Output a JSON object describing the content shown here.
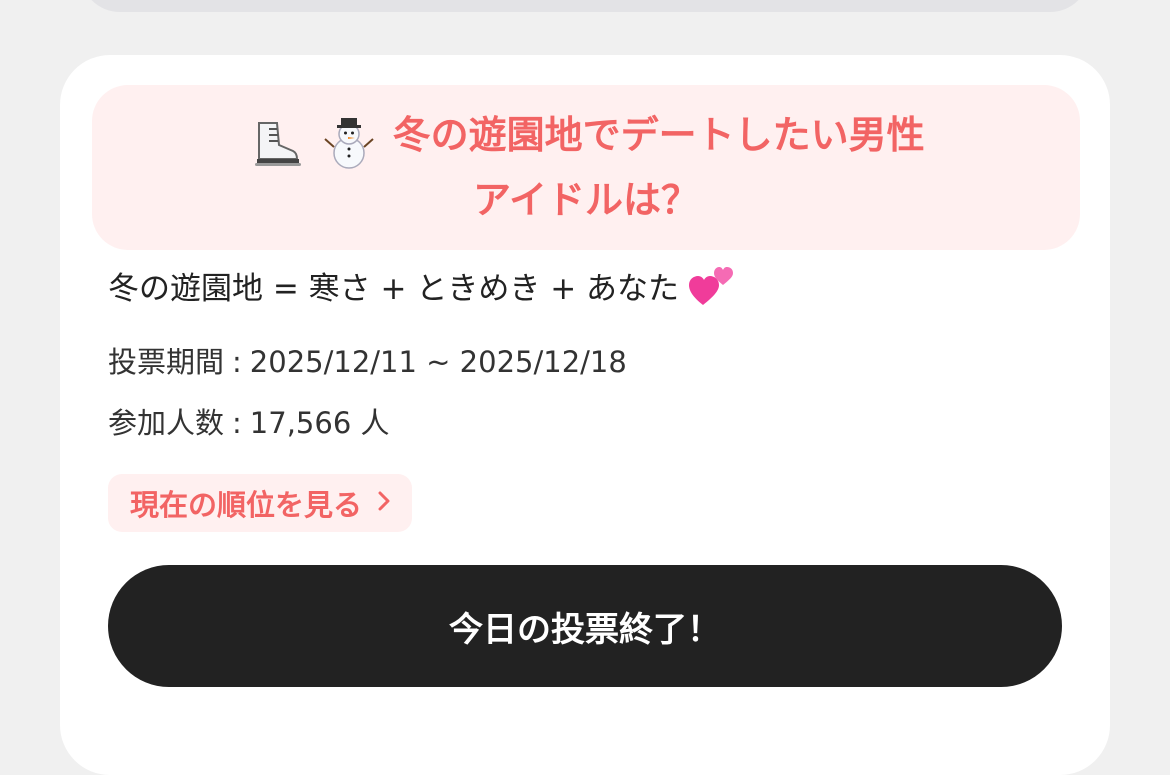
{
  "poll": {
    "title_icons": [
      "ice-skate-icon",
      "snowman-icon"
    ],
    "title": "冬の遊園地でデートしたい男性アイドルは？",
    "title_line1": "冬の遊園地でデートしたい男性",
    "title_line2": "アイドルは？",
    "subtitle": "冬の遊園地 = 寒さ + ときめき + あなた",
    "subtitle_icon": "two-hearts-icon",
    "period_label": "投票期間",
    "period_value": "2025/12/11 ~ 2025/12/18",
    "participants_label": "参加人数",
    "participants_value": "17,566 人",
    "separator": ":",
    "ranking_button_label": "現在の順位を見る",
    "ranking_button_icon": "chevron-right-icon",
    "vote_button_label": "今日の投票終了！"
  },
  "colors": {
    "accent": "#f26464",
    "accent_bg": "#fff0f0",
    "button_dark": "#222222",
    "page_bg": "#f0f0f0"
  }
}
